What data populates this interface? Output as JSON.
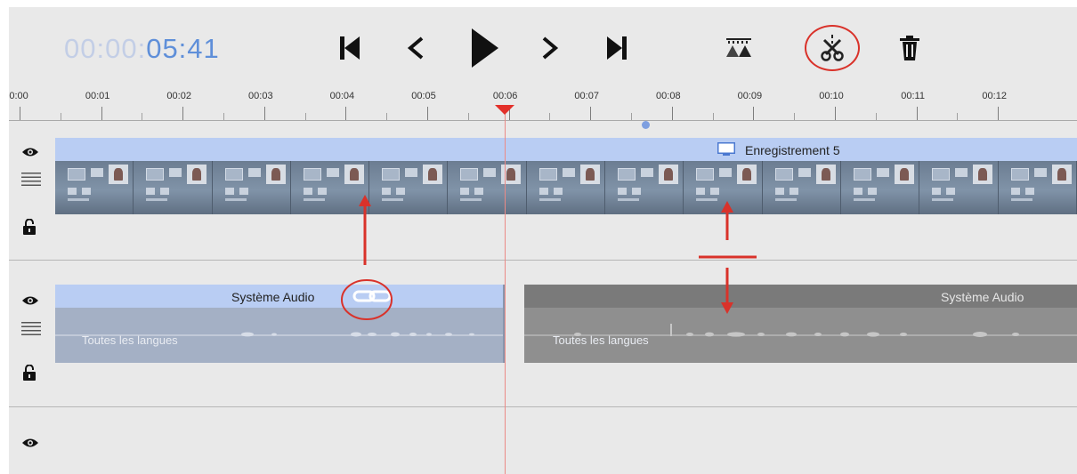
{
  "toolbar": {
    "timecode": {
      "prefix": "00:00:",
      "value": "05:41"
    },
    "buttons": [
      {
        "name": "skip-to-start",
        "icon": "skip-start-icon"
      },
      {
        "name": "previous-frame",
        "icon": "chevron-left-icon"
      },
      {
        "name": "play",
        "icon": "play-icon"
      },
      {
        "name": "next-frame",
        "icon": "chevron-right-icon"
      },
      {
        "name": "skip-to-end",
        "icon": "skip-end-icon"
      },
      {
        "name": "trim",
        "icon": "trim-icon"
      },
      {
        "name": "split",
        "icon": "scissors-icon"
      },
      {
        "name": "delete",
        "icon": "trash-icon"
      }
    ]
  },
  "ruler": {
    "labels": [
      "00:00",
      "00:01",
      "00:02",
      "00:03",
      "00:04",
      "00:05",
      "00:06",
      "00:07",
      "00:08",
      "00:09",
      "00:10",
      "00:11",
      "00:12"
    ]
  },
  "tracks": {
    "video": {
      "clip_title": "Enregistrement 5"
    },
    "audio": {
      "clip_a": {
        "title": "Système Audio",
        "subtitle": "Toutes les langues"
      },
      "clip_b": {
        "title": "Système Audio",
        "subtitle": "Toutes les langues"
      }
    }
  },
  "colors": {
    "accent": "#5f8fd9",
    "timecode_dim": "#c3cee6",
    "annotation": "#d9322a",
    "video_clip": "#b9cdf3",
    "audio_linked": "#a4b0c5",
    "audio_unlinked": "#8f8f8f"
  }
}
